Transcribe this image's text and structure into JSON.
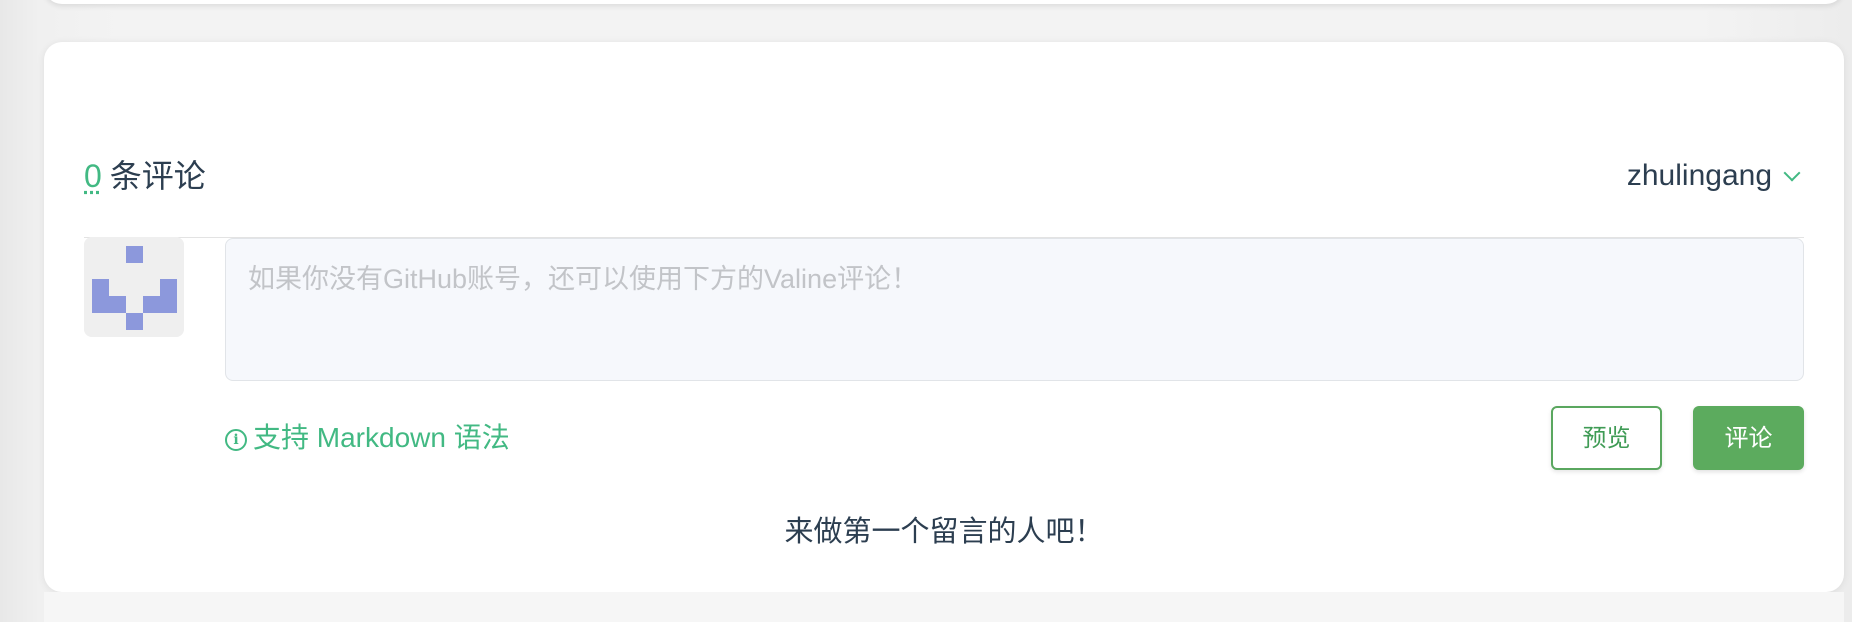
{
  "header": {
    "comment_count": "0",
    "comment_count_suffix": "条评论",
    "username": "zhulingang"
  },
  "editor": {
    "placeholder": "如果你没有GitHub账号，还可以使用下方的Valine评论！"
  },
  "hint": {
    "text": "支持 Markdown 语法",
    "icon": "info-icon"
  },
  "buttons": {
    "preview_label": "预览",
    "submit_label": "评论"
  },
  "empty_state": {
    "text": "来做第一个留言的人吧！"
  },
  "colors": {
    "accent": "#42b983",
    "button_green": "#5cab5e",
    "text": "#2c3e50",
    "avatar_blue": "#8c98dc"
  }
}
